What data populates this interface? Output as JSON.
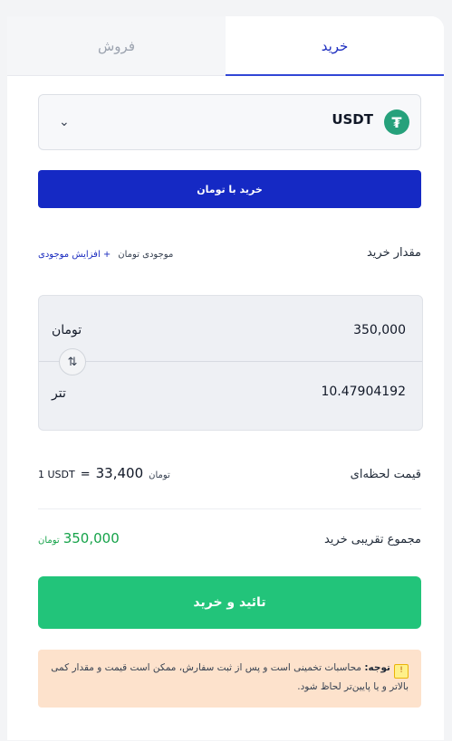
{
  "tabs": {
    "buy": "خرید",
    "sell": "فروش"
  },
  "coin": {
    "symbol": "USDT",
    "icon": "tether-icon"
  },
  "pay_button": "خرید با تومان",
  "amount": {
    "title": "مقدار خرید",
    "balance_label": "موجودی تومان",
    "increase_label": "+ افزایش موجودی"
  },
  "calculator": {
    "toman_value": "350,000",
    "toman_label": "تومان",
    "usdt_value": "10.47904192",
    "usdt_label": "تتر",
    "swap_icon": "swap-vertical-icon"
  },
  "rate": {
    "title": "قیمت لحظه‌ای",
    "unit": "1 USDT",
    "eq": "=",
    "price": "33,400",
    "currency": "تومان"
  },
  "total": {
    "title": "مجموع تقریبی خرید",
    "value": "350,000",
    "currency": "تومان"
  },
  "confirm_button": "تائید و خرید",
  "note": {
    "lead": "توجه:",
    "text": " محاسبات تخمینی است و پس از ثبت سفارش، ممکن است قیمت و مقدار کمی بالاتر و یا پایین‌تر لحاظ شود."
  },
  "colors": {
    "primary_blue": "#1529c4",
    "green": "#22c47a",
    "tether": "#26a17b",
    "note_bg": "#fde2cc"
  }
}
